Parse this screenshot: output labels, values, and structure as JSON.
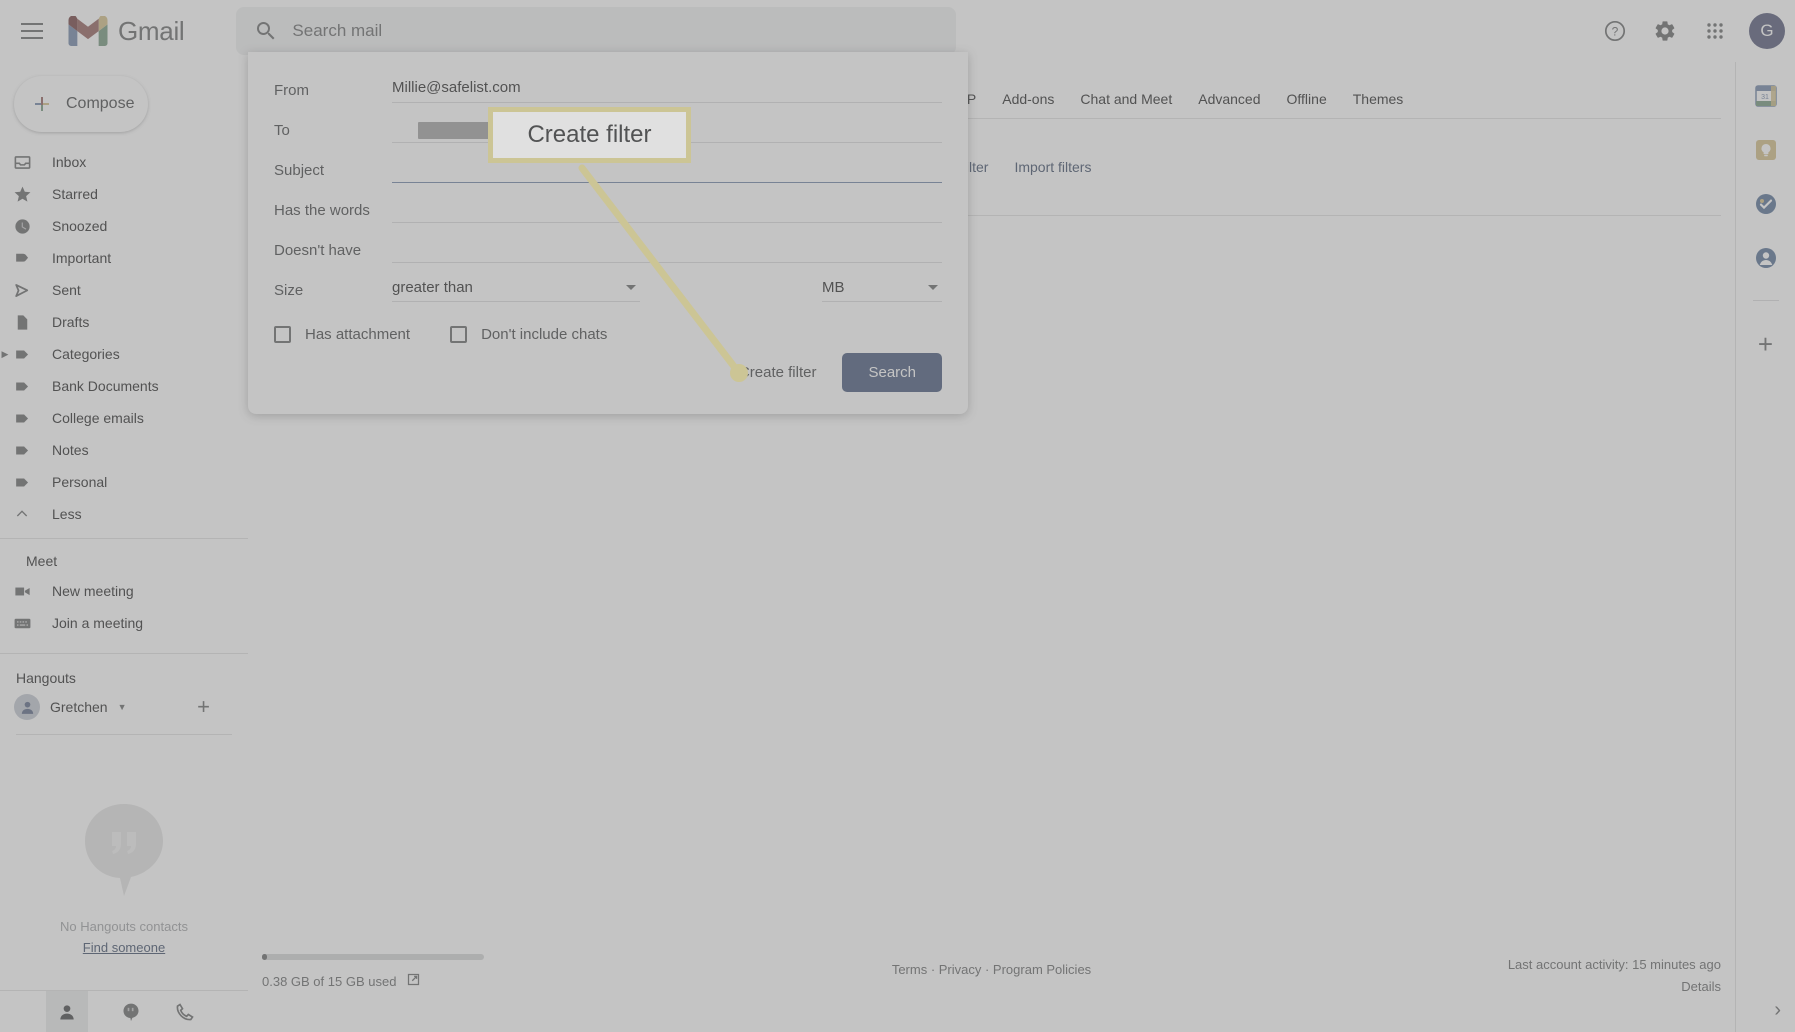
{
  "app": {
    "name": "Gmail",
    "menu_icon": "hamburger-icon",
    "logo_icon": "gmail-m-logo"
  },
  "search": {
    "placeholder": "Search mail",
    "icon": "search-icon",
    "value": ""
  },
  "topbar_icons": [
    {
      "name": "help-icon",
      "glyph": "?"
    },
    {
      "name": "settings-gear-icon",
      "glyph": "gear"
    },
    {
      "name": "apps-grid-icon",
      "glyph": "grid"
    }
  ],
  "account": {
    "avatar_letter": "G",
    "avatar_color": "#3f51b5"
  },
  "compose": {
    "label": "Compose",
    "icon": "plus-icon"
  },
  "sidebar": {
    "items": [
      {
        "label": "Inbox",
        "icon": "inbox-icon",
        "caret": false
      },
      {
        "label": "Starred",
        "icon": "star-icon",
        "caret": false
      },
      {
        "label": "Snoozed",
        "icon": "clock-icon",
        "caret": false
      },
      {
        "label": "Important",
        "icon": "important-icon",
        "caret": false
      },
      {
        "label": "Sent",
        "icon": "send-icon",
        "caret": false
      },
      {
        "label": "Drafts",
        "icon": "draft-icon",
        "caret": false
      },
      {
        "label": "Categories",
        "icon": "label-icon",
        "caret": true
      },
      {
        "label": "Bank Documents",
        "icon": "label-icon",
        "caret": false
      },
      {
        "label": "College emails",
        "icon": "label-icon",
        "caret": false
      },
      {
        "label": "Notes",
        "icon": "label-icon",
        "caret": false
      },
      {
        "label": "Personal",
        "icon": "label-icon",
        "caret": false
      },
      {
        "label": "Less",
        "icon": "chevron-up-icon",
        "caret": false
      }
    ],
    "meet": {
      "title": "Meet",
      "items": [
        {
          "label": "New meeting",
          "icon": "video-camera-icon"
        },
        {
          "label": "Join a meeting",
          "icon": "keyboard-icon"
        }
      ]
    },
    "hangouts": {
      "title": "Hangouts",
      "user": "Gretchen",
      "add_icon": "plus-icon",
      "empty_text": "No Hangouts contacts",
      "find_link": "Find someone",
      "bar_icons": [
        {
          "name": "person-icon"
        },
        {
          "name": "hangouts-quote-icon"
        },
        {
          "name": "phone-icon"
        }
      ]
    }
  },
  "settings": {
    "tabs": [
      {
        "label": "IMAP"
      },
      {
        "label": "Add-ons"
      },
      {
        "label": "Chat and Meet"
      },
      {
        "label": "Advanced"
      },
      {
        "label": "Offline"
      },
      {
        "label": "Themes"
      }
    ],
    "links": [
      {
        "label": "filter"
      },
      {
        "label": "Import filters"
      }
    ]
  },
  "dialog": {
    "fields": [
      {
        "label": "From",
        "value": "Millie@safelist.com",
        "masked": false,
        "focused": false
      },
      {
        "label": "To",
        "value": "",
        "masked": true,
        "focused": false
      },
      {
        "label": "Subject",
        "value": "",
        "masked": false,
        "focused": true
      },
      {
        "label": "Has the words",
        "value": "",
        "masked": false,
        "focused": false
      },
      {
        "label": "Doesn't have",
        "value": "",
        "masked": false,
        "focused": false
      }
    ],
    "size": {
      "label": "Size",
      "operator": "greater than",
      "unit": "MB",
      "amount": ""
    },
    "checkboxes": [
      {
        "label": "Has attachment",
        "checked": false
      },
      {
        "label": "Don't include chats",
        "checked": false
      }
    ],
    "create_filter_label": "Create filter",
    "search_button_label": "Search"
  },
  "annotation": {
    "callout_text": "Create filter",
    "highlight_color": "#ffe014"
  },
  "footer": {
    "storage_text": "0.38 GB of 15 GB used",
    "storage_icon": "open-in-new-icon",
    "storage_percent": 2,
    "terms": "Terms · Privacy · Program Policies",
    "last_activity": "Last account activity: 15 minutes ago",
    "details": "Details"
  },
  "rail": {
    "icons": [
      {
        "name": "google-calendar-icon"
      },
      {
        "name": "google-keep-icon"
      },
      {
        "name": "google-tasks-icon"
      },
      {
        "name": "google-contacts-icon"
      }
    ],
    "add_icon": "plus-icon",
    "expand_icon": "chevron-right-icon"
  }
}
